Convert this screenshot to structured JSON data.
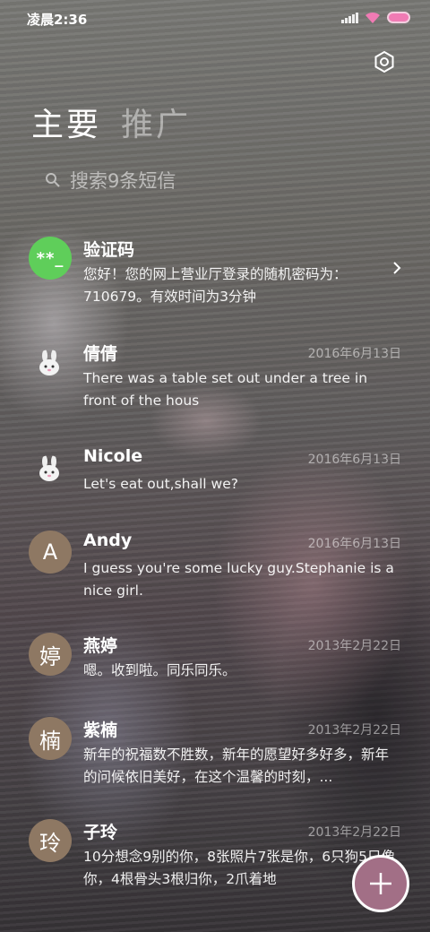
{
  "status_bar": {
    "time": "凌晨2:36"
  },
  "tabs": [
    {
      "label": "主要",
      "active": true
    },
    {
      "label": "推广",
      "active": false
    }
  ],
  "search": {
    "placeholder": "搜索9条短信"
  },
  "conversations": [
    {
      "avatar": "**_",
      "avatar_color": "#5fce5a",
      "name": "验证码",
      "date": "",
      "preview": "您好！您的网上营业厅登录的随机密码为：710679。有效时间为3分钟"
    },
    {
      "avatar": "bunny-icon",
      "name": "倩倩",
      "date": "2016年6月13日",
      "preview": "There was a table set out under a tree in front of the hous"
    },
    {
      "avatar": "bunny-icon",
      "name": "Nicole",
      "date": "2016年6月13日",
      "preview": "Let's eat out,shall we?"
    },
    {
      "avatar": "A",
      "avatar_color": "#8e7863",
      "name": "Andy",
      "date": "2016年6月13日",
      "preview": "I guess you're some lucky guy.Stephanie is a nice girl."
    },
    {
      "avatar": "婷",
      "avatar_color": "#8e7863",
      "name": "燕婷",
      "date": "2013年2月22日",
      "preview": "嗯。收到啦。同乐同乐。"
    },
    {
      "avatar": "楠",
      "avatar_color": "#8e7863",
      "name": "紫楠",
      "date": "2013年2月22日",
      "preview": "新年的祝福数不胜数，新年的愿望好多好多，新年的问候依旧美好，在这个温馨的时刻，..."
    },
    {
      "avatar": "玲",
      "avatar_color": "#8e7863",
      "name": "子玲",
      "date": "2013年2月22日",
      "preview": "10分想念9别的你，8张照片7张是你，6只狗5只像你，4根骨头3根归你，2爪着地"
    }
  ],
  "fab": {
    "icon": "plus-icon",
    "color": "#a26f86"
  }
}
